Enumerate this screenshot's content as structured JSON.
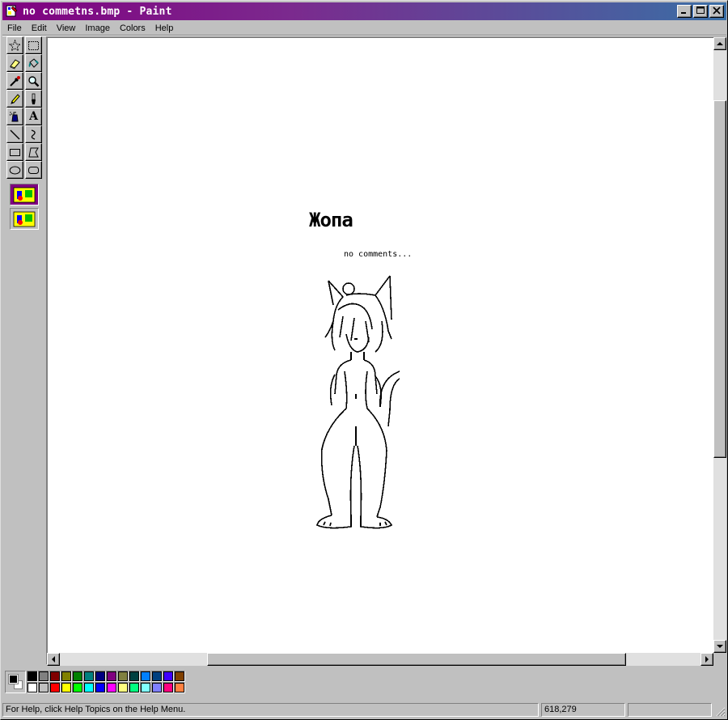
{
  "window": {
    "title": "no commetns.bmp - Paint",
    "app_icon": "paint-icon",
    "controls": [
      "minimize-icon",
      "maximize-icon",
      "close-icon"
    ]
  },
  "menu": [
    "File",
    "Edit",
    "View",
    "Image",
    "Colors",
    "Help"
  ],
  "tools": [
    {
      "name": "free-form-select",
      "icon": "star-select-icon"
    },
    {
      "name": "select",
      "icon": "rect-select-icon"
    },
    {
      "name": "eraser",
      "icon": "eraser-icon"
    },
    {
      "name": "fill-with-color",
      "icon": "paint-bucket-icon"
    },
    {
      "name": "pick-color",
      "icon": "eyedropper-icon"
    },
    {
      "name": "magnifier",
      "icon": "magnifier-icon"
    },
    {
      "name": "pencil",
      "icon": "pencil-icon"
    },
    {
      "name": "brush",
      "icon": "brush-icon"
    },
    {
      "name": "airbrush",
      "icon": "airbrush-icon"
    },
    {
      "name": "text",
      "icon": "text-icon",
      "glyph": "A"
    },
    {
      "name": "line",
      "icon": "line-icon"
    },
    {
      "name": "curve",
      "icon": "curve-icon"
    },
    {
      "name": "rectangle",
      "icon": "rectangle-icon"
    },
    {
      "name": "polygon",
      "icon": "polygon-icon"
    },
    {
      "name": "ellipse",
      "icon": "ellipse-icon"
    },
    {
      "name": "rounded-rectangle",
      "icon": "rounded-rectangle-icon"
    }
  ],
  "tool_options": [
    "opaque-background-icon",
    "transparent-background-icon"
  ],
  "canvas": {
    "heading": "Жопа",
    "caption": "no comments...",
    "drawing": "cat-girl-sketch"
  },
  "colors": {
    "foreground": "#000000",
    "background": "#ffffff",
    "title_gradient_start": "#800080",
    "title_gradient_end": "#3a6ea5",
    "palette_row1": [
      "#000000",
      "#808080",
      "#800000",
      "#808000",
      "#008000",
      "#008080",
      "#000080",
      "#800080",
      "#808040",
      "#004040",
      "#0080ff",
      "#004080",
      "#4000ff",
      "#804000"
    ],
    "palette_row2": [
      "#ffffff",
      "#c0c0c0",
      "#ff0000",
      "#ffff00",
      "#00ff00",
      "#00ffff",
      "#0000ff",
      "#ff00ff",
      "#ffff80",
      "#00ff80",
      "#80ffff",
      "#8080ff",
      "#ff0080",
      "#ff8040"
    ]
  },
  "status": {
    "help_text": "For Help, click Help Topics on the Help Menu.",
    "coords": "618,279",
    "size": ""
  }
}
